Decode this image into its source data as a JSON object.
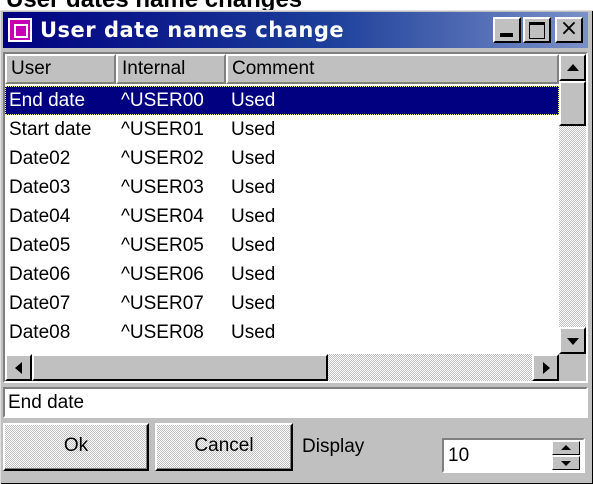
{
  "page_heading": "User dates name changes",
  "window": {
    "title": "User date names change",
    "icon": "dialog-app-icon",
    "controls": {
      "minimize": "minimize-icon",
      "maximize": "maximize-icon",
      "close_glyph": "×"
    }
  },
  "list": {
    "columns": [
      "User",
      "Internal",
      "Comment"
    ],
    "rows": [
      {
        "user": "End date",
        "internal": "^USER00",
        "comment": "Used",
        "selected": true
      },
      {
        "user": "Start date",
        "internal": "^USER01",
        "comment": "Used"
      },
      {
        "user": "Date02",
        "internal": "^USER02",
        "comment": "Used"
      },
      {
        "user": "Date03",
        "internal": "^USER03",
        "comment": "Used"
      },
      {
        "user": "Date04",
        "internal": "^USER04",
        "comment": "Used"
      },
      {
        "user": "Date05",
        "internal": "^USER05",
        "comment": "Used"
      },
      {
        "user": "Date06",
        "internal": "^USER06",
        "comment": "Used"
      },
      {
        "user": "Date07",
        "internal": "^USER07",
        "comment": "Used"
      },
      {
        "user": "Date08",
        "internal": "^USER08",
        "comment": "Used"
      }
    ]
  },
  "edit": {
    "value": "End date"
  },
  "buttons": {
    "ok": "Ok",
    "cancel": "Cancel"
  },
  "display": {
    "label": "Display",
    "value": "10"
  },
  "colors": {
    "selection": "#000080",
    "face": "#c0c0c0",
    "title_start": "#000080"
  }
}
